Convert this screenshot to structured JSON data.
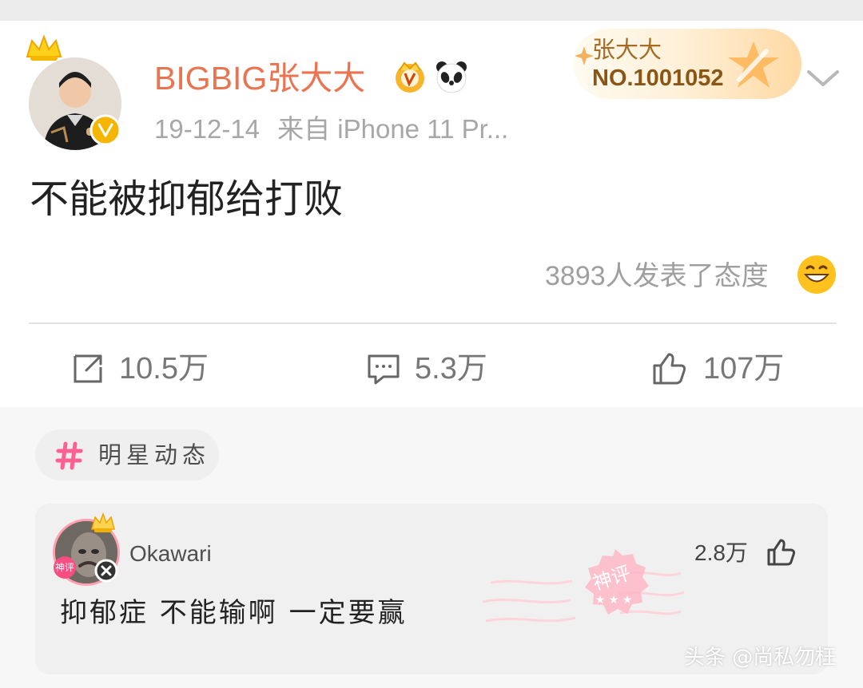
{
  "post": {
    "username": "BIGBIG张大大",
    "date": "19-12-14",
    "source": "来自 iPhone 11 Pr...",
    "text": "不能被抑郁给打败",
    "reactions": "3893人发表了态度"
  },
  "fan_card": {
    "name": "张大大",
    "number": "NO.1001052"
  },
  "actions": {
    "repost": "10.5万",
    "comment": "5.3万",
    "like": "107万"
  },
  "topic": {
    "label": "明星动态"
  },
  "comment": {
    "name": "Okawari",
    "likes": "2.8万",
    "text": "抑郁症 不能输啊 一定要赢",
    "medal_text": "神评",
    "avatar_badge_text": "神评"
  },
  "watermark": {
    "text": "头条 @尚私勿枉"
  },
  "colors": {
    "username": "#eb7350",
    "verified": "#f6b500",
    "accent_pink": "#ff5f93"
  },
  "icons": {
    "crown": "crown-icon",
    "verified": "verified-icon",
    "vip": "vip-badge-icon",
    "panda": "panda-icon",
    "chevron": "chevron-down-icon",
    "laugh": "laugh-icon",
    "repost": "repost-icon",
    "comment": "comment-icon",
    "like": "like-icon",
    "hash": "hash-icon"
  }
}
